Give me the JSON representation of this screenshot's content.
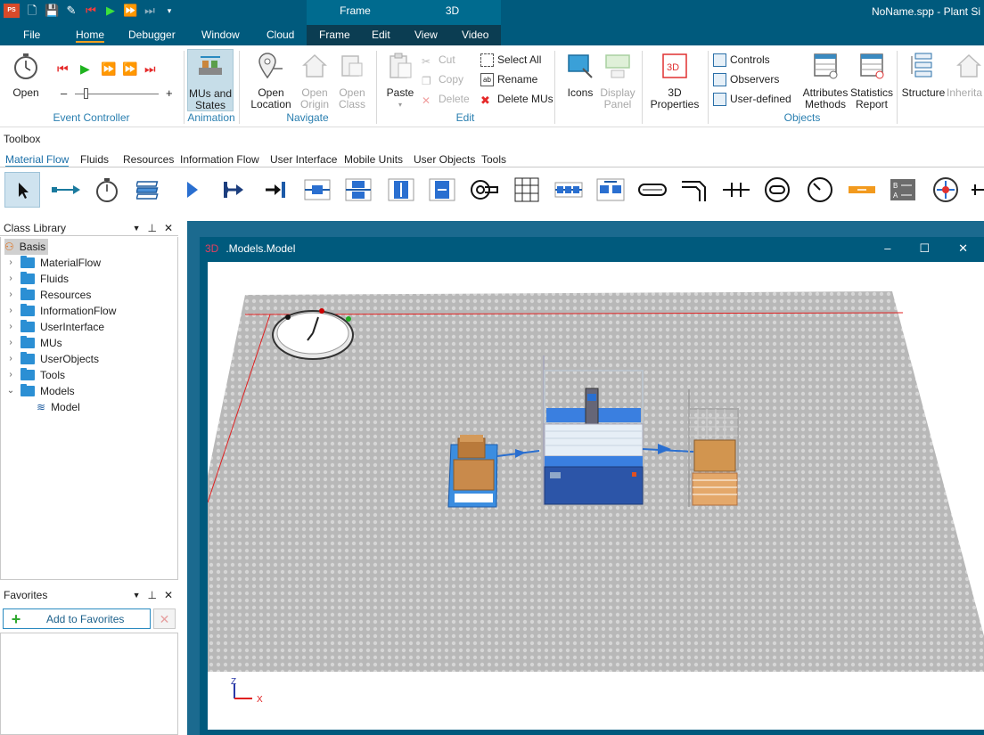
{
  "titlebar": {
    "doc_title": "NoName.spp - Plant Si",
    "context_group_frame": "Frame",
    "context_group_3d": "3D"
  },
  "tabs": {
    "file": "File",
    "home": "Home",
    "debugger": "Debugger",
    "window": "Window",
    "cloud": "Cloud",
    "frame": "Frame",
    "edit": "Edit",
    "view": "View",
    "video": "Video"
  },
  "ribbon": {
    "event_controller": {
      "label": "Event Controller",
      "open": "Open",
      "minus": "–",
      "plus": "+"
    },
    "animation": {
      "label": "Animation",
      "mus_states": "MUs and\nStates"
    },
    "navigate": {
      "label": "Navigate",
      "open_location": "Open\nLocation",
      "open_origin": "Open\nOrigin",
      "open_class": "Open\nClass"
    },
    "edit": {
      "label": "Edit",
      "paste": "Paste",
      "cut": "Cut",
      "copy": "Copy",
      "delete": "Delete",
      "select_all": "Select All",
      "rename": "Rename",
      "delete_mus": "Delete MUs"
    },
    "icons": "Icons",
    "display_panel": "Display\nPanel",
    "properties_3d": "3D\nProperties",
    "objects": {
      "label": "Objects",
      "controls": "Controls",
      "observers": "Observers",
      "user_defined": "User-defined",
      "attributes_methods": "Attributes\nMethods",
      "statistics_report": "Statistics\nReport",
      "structure": "Structure",
      "inheritance": "Inherita"
    }
  },
  "toolbox": {
    "label": "Toolbox",
    "tabs": [
      "Material Flow",
      "Fluids",
      "Resources",
      "Information Flow",
      "User Interface",
      "Mobile Units",
      "User Objects",
      "Tools"
    ]
  },
  "class_library": {
    "title": "Class Library",
    "root": "Basis",
    "items": [
      "MaterialFlow",
      "Fluids",
      "Resources",
      "InformationFlow",
      "UserInterface",
      "MUs",
      "UserObjects",
      "Tools",
      "Models"
    ],
    "model": "Model"
  },
  "favorites": {
    "title": "Favorites",
    "add_label": "Add to Favorites"
  },
  "model_window": {
    "prefix": "3D",
    "title": ".Models.Model",
    "axis_z": "Z",
    "axis_x": "X"
  }
}
